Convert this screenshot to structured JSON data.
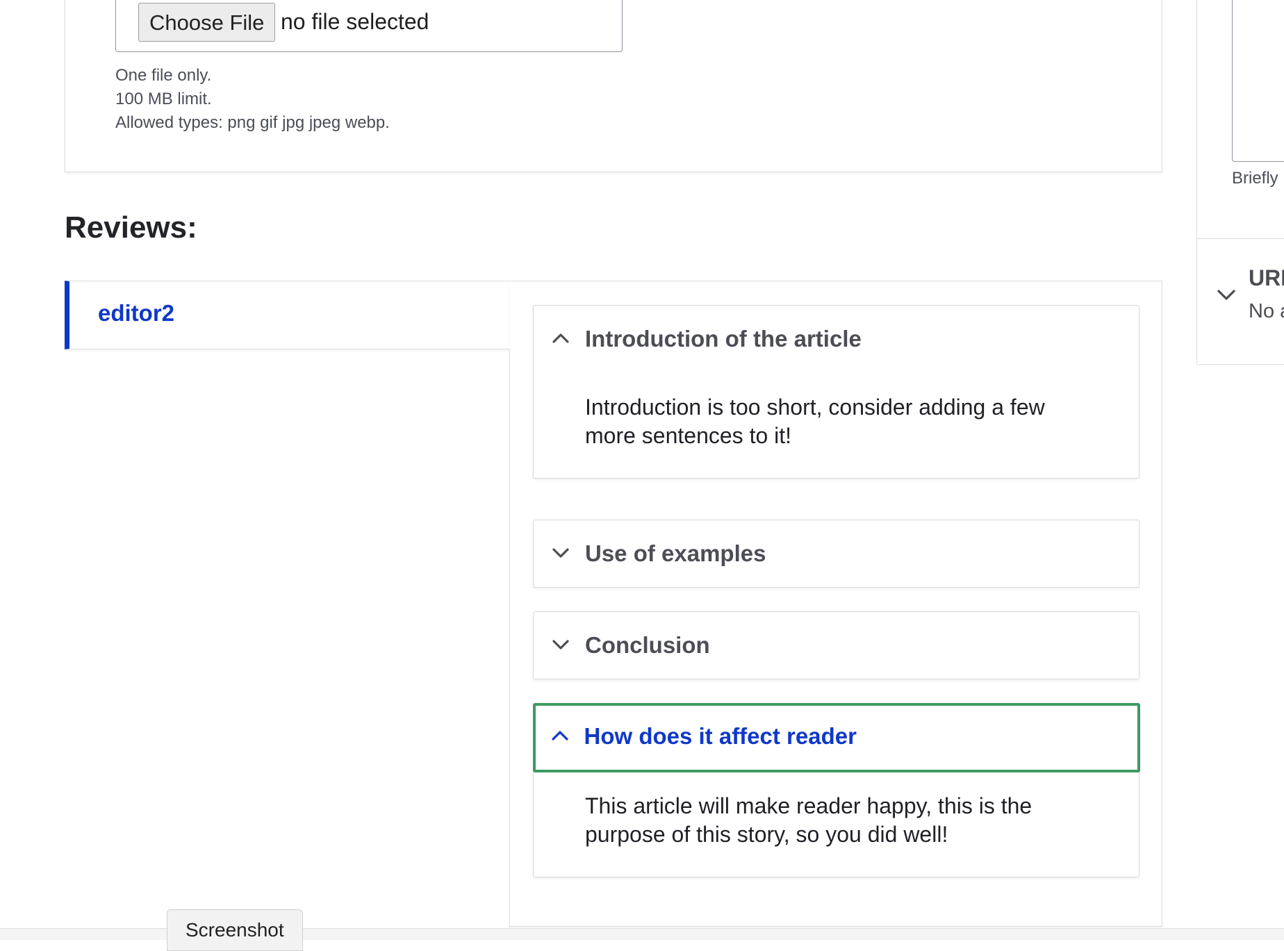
{
  "upload": {
    "choose_file_label": "Choose File",
    "file_status": "no file selected",
    "help": {
      "line1": "One file only.",
      "line2": "100 MB limit.",
      "line3": "Allowed types: png gif jpg jpeg webp."
    }
  },
  "reviews": {
    "heading": "Reviews:",
    "reviewer": "editor2",
    "sections": [
      {
        "title": "Introduction of the article",
        "expanded": true,
        "body": "Introduction is too short, consider adding a few more sentences to it!"
      },
      {
        "title": "Use of examples",
        "expanded": false
      },
      {
        "title": "Conclusion",
        "expanded": false
      },
      {
        "title": "How does it affect reader",
        "expanded": true,
        "focused": true,
        "body": "This article will make reader happy,  this is the purpose of this story, so you did well!"
      }
    ]
  },
  "sidebar": {
    "help_text": "Briefly",
    "section_title": "URL",
    "section_sub": "No a"
  },
  "bottom": {
    "screenshot_label": "Screenshot"
  },
  "colors": {
    "link_blue": "#0f38c8",
    "focus_green": "#3e9b62",
    "border": "#dcdde3"
  },
  "icons": {
    "expanded": "chevron-up-icon",
    "collapsed": "chevron-down-icon"
  }
}
